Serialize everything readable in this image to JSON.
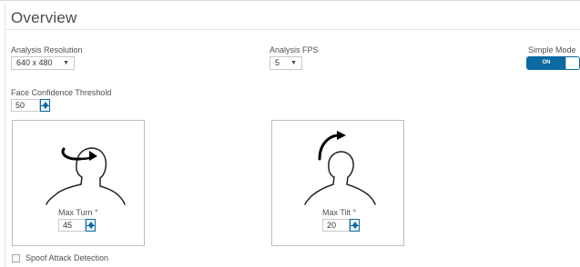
{
  "header": {
    "title": "Overview"
  },
  "analysis_resolution": {
    "label": "Analysis Resolution",
    "value": "640 x 480"
  },
  "analysis_fps": {
    "label": "Analysis FPS",
    "value": "5"
  },
  "simple_mode": {
    "label": "Simple Mode",
    "toggle_text": "ON",
    "state": "on"
  },
  "face_confidence": {
    "label": "Face Confidence Threshold",
    "value": "50"
  },
  "max_turn": {
    "label": "Max Turn °",
    "value": "45",
    "icon": "head-turn-icon"
  },
  "max_tilt": {
    "label": "Max Tilt °",
    "value": "20",
    "icon": "head-tilt-icon"
  },
  "spoof": {
    "label": "Spoof Attack Detection",
    "checked": false
  },
  "colors": {
    "accent": "#0a6aa1",
    "spinner_bg": "#e9f3fa",
    "border": "#bdbdbd"
  }
}
